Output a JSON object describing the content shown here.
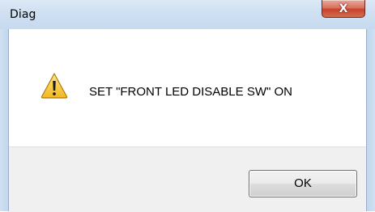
{
  "dialog": {
    "title": "Diag",
    "close_glyph": "X",
    "message": "SET \"FRONT LED DISABLE SW\" ON",
    "icon": "warning-icon",
    "ok_label": "OK"
  },
  "colors": {
    "title_bar": "#cfe0f2",
    "close_button": "#c7452f",
    "button_area": "#f0f0f0",
    "warning_fill": "#f7c948"
  }
}
